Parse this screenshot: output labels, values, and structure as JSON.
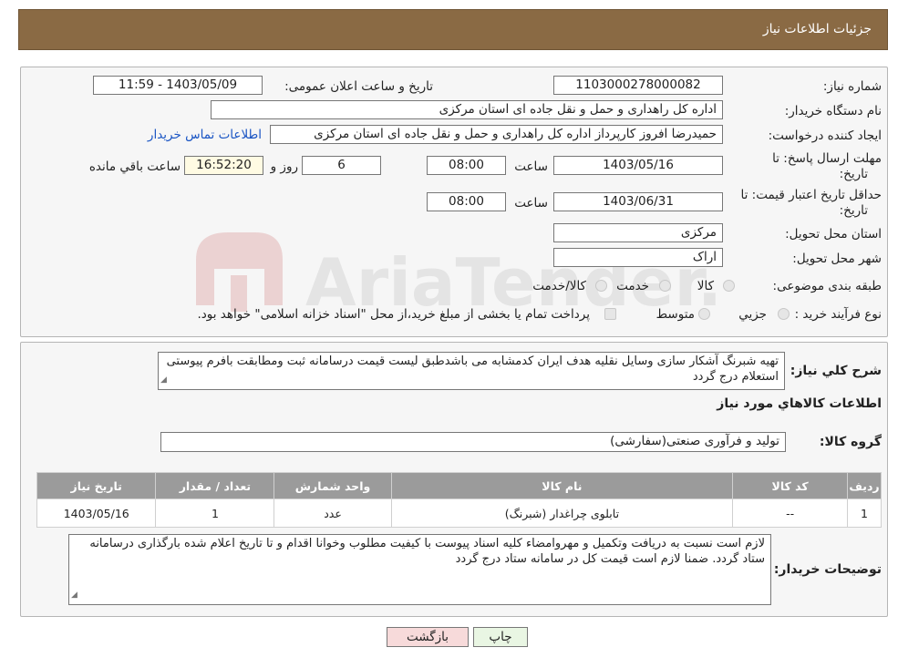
{
  "header": {
    "title": "جزئیات اطلاعات نیاز"
  },
  "fields": {
    "need_number_label": "شماره نیاز:",
    "need_number": "1103000278000082",
    "announce_label": "تاریخ و ساعت اعلان عمومی:",
    "announce_value": "1403/05/09 - 11:59",
    "buyer_org_label": "نام دستگاه خریدار:",
    "buyer_org": "اداره کل راهداری و حمل و نقل جاده ای استان مرکزی",
    "requester_label": "ایجاد کننده درخواست:",
    "requester": "حمیدرضا  افروز  کارپرداز اداره کل راهداری و حمل و نقل جاده ای استان مرکزی",
    "contact_link": "اطلاعات تماس خریدار",
    "deadline_label_1": "مهلت ارسال پاسخ: تا",
    "deadline_label_2": "تاریخ:",
    "deadline_date": "1403/05/16",
    "time_label": "ساعت",
    "deadline_time": "08:00",
    "days_value": "6",
    "days_label": "روز و",
    "remaining_time": "16:52:20",
    "remaining_label": "ساعت باقي مانده",
    "validity_label_1": "حداقل تاریخ اعتبار قیمت: تا",
    "validity_label_2": "تاریخ:",
    "validity_date": "1403/06/31",
    "validity_time": "08:00",
    "province_label": "استان محل تحویل:",
    "province": "مرکزی",
    "city_label": "شهر محل تحویل:",
    "city": "اراک",
    "category_label": "طبقه بندی موضوعی:",
    "category_options": [
      "کالا",
      "خدمت",
      "کالا/خدمت"
    ],
    "process_label": "نوع فرآیند خرید :",
    "process_options": [
      "جزیي",
      "متوسط"
    ],
    "process_note": "پرداخت تمام یا بخشی از مبلغ خرید،از محل \"اسناد خزانه اسلامی\" خواهد بود."
  },
  "description": {
    "label": "شرح کلي نياز:",
    "text": "تهیه شبرنگ آشکار سازی وسایل نقلیه هدف ایران کدمشابه می باشدطبق لیست قیمت درسامانه ثبت ومطابقت بافرم پیوستی استعلام درج گردد"
  },
  "goods_info": {
    "title": "اطلاعات کالاهاي مورد نياز",
    "group_label": "گروه کالا:",
    "group_value": "تولید و فرآوری صنعتی(سفارشی)"
  },
  "table": {
    "headers": [
      "رديف",
      "کد کالا",
      "نام کالا",
      "واحد شمارش",
      "تعداد / مقدار",
      "تاريخ نياز"
    ],
    "rows": [
      [
        "1",
        "--",
        "تابلوی چراغدار (شبرنگ)",
        "عدد",
        "1",
        "1403/05/16"
      ]
    ]
  },
  "buyer_notes": {
    "label": "توضیحات خریدار:",
    "text": "لازم است نسبت به دریافت وتکمیل و مهروامضاء کلیه اسناد پیوست با کیفیت مطلوب وخوانا اقدام و تا تاریخ اعلام شده بارگذاری درسامانه ستاد گردد. ضمنا لازم است قیمت کل در سامانه ستاد درج گردد"
  },
  "buttons": {
    "print": "چاپ",
    "back": "بازگشت"
  },
  "watermark": {
    "text": "AriaTender.neT"
  },
  "colors": {
    "header_bg": "#8a6a44",
    "table_header": "#9b9b9b",
    "back_btn": "#f7dada",
    "print_btn": "#e9f6e3",
    "link": "#1a55c4"
  }
}
